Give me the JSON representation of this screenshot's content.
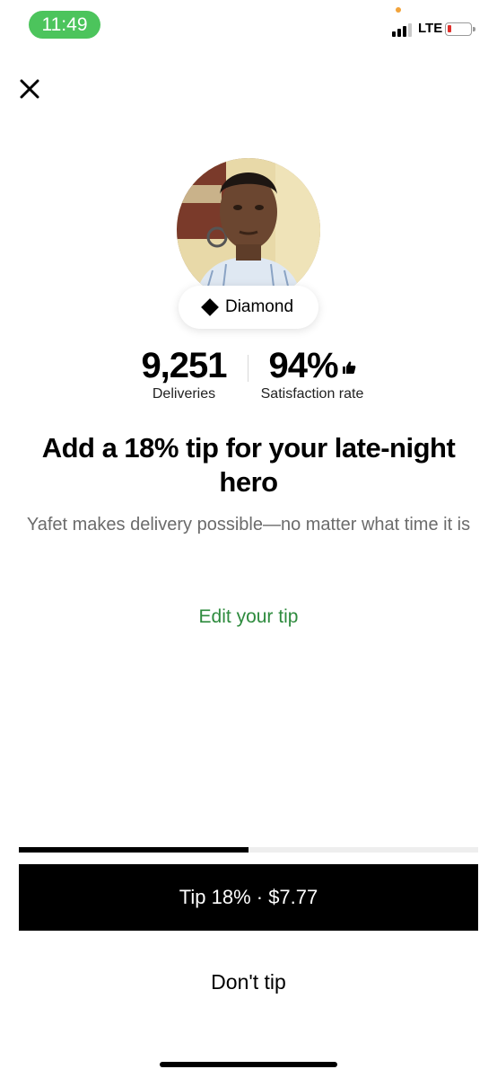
{
  "status_bar": {
    "time": "11:49",
    "network": "LTE",
    "signal_bars_active": 3,
    "signal_bars_total": 4,
    "battery_level": 0.1,
    "battery_color": "#e0302b",
    "time_pill_color": "#4cc45c"
  },
  "header": {
    "close_icon": "close-icon"
  },
  "courier": {
    "tier": "Diamond",
    "stats": [
      {
        "value": "9,251",
        "label": "Deliveries"
      },
      {
        "value": "94%",
        "label": "Satisfaction rate",
        "icon": "thumbs-up-icon"
      }
    ]
  },
  "message": {
    "headline": "Add a 18% tip for your late-night hero",
    "subtext": "Yafet makes delivery possible—no matter what time it is"
  },
  "actions": {
    "edit_tip": "Edit your tip",
    "tip_button": "Tip 18% · $7.77",
    "dont_tip": "Don't tip",
    "progress_fraction": 0.5
  },
  "colors": {
    "accent_green": "#2e8b3e",
    "primary_button": "#000000"
  }
}
